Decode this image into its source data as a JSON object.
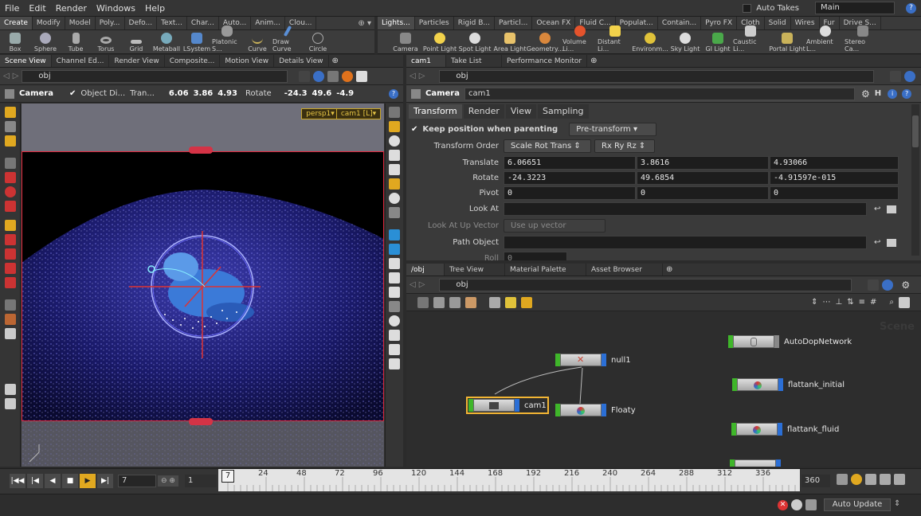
{
  "menu": [
    "File",
    "Edit",
    "Render",
    "Windows",
    "Help"
  ],
  "topright": {
    "auto_takes": "Auto Takes",
    "desktop": "Main"
  },
  "shelf_left_tabs": [
    "Create",
    "Modify",
    "Model",
    "Poly...",
    "Defo...",
    "Text...",
    "Char...",
    "Auto...",
    "Anim...",
    "Clou..."
  ],
  "shelf_right_tabs": [
    "Lights...",
    "Particles",
    "Rigid B...",
    "Particl...",
    "Ocean FX",
    "Fluid C...",
    "Populat...",
    "Contain...",
    "Pyro FX",
    "Cloth",
    "Solid",
    "Wires",
    "Fur",
    "Drive S..."
  ],
  "tools_left": [
    "Box",
    "Sphere",
    "Tube",
    "Torus",
    "Grid",
    "Metaball",
    "LSystem",
    "Platonic S...",
    "Curve",
    "Draw Curve",
    "Circle"
  ],
  "tools_right": [
    "Camera",
    "Point Light",
    "Spot Light",
    "Area Light",
    "Geometry...",
    "Volume Li...",
    "Distant Li...",
    "Environm...",
    "Sky Light",
    "GI Light",
    "Caustic Li...",
    "Portal Light",
    "Ambient L...",
    "Stereo Ca..."
  ],
  "left_tabs": [
    "Scene View",
    "Channel Ed...",
    "Render View",
    "Composite...",
    "Motion View",
    "Details View"
  ],
  "left_path": "obj",
  "viewer_toolbar": {
    "label": "Camera",
    "object_di": "Object Di...",
    "tran": "Tran...",
    "t1": "6.06",
    "t2": "3.86",
    "t3": "4.93",
    "rotate": "Rotate",
    "r1": "-24.3",
    "r2": "49.6",
    "r3": "-4.9"
  },
  "viewport": {
    "persp": "persp1▾",
    "cam": "cam1 [L]▾"
  },
  "right_tabs": [
    "cam1",
    "Take List",
    "Performance Monitor"
  ],
  "right_path": "obj",
  "parm": {
    "type": "Camera",
    "name": "cam1",
    "tabs": [
      "Transform",
      "Render",
      "View",
      "Sampling"
    ],
    "keep_position": "Keep position when parenting",
    "pre_transform": "Pre-transform",
    "transform_order_label": "Transform Order",
    "transform_order": "Scale Rot Trans",
    "rot_order": "Rx Ry Rz",
    "translate_label": "Translate",
    "translate": [
      "6.06651",
      "3.8616",
      "4.93066"
    ],
    "rotate_label": "Rotate",
    "rotate": [
      "-24.3223",
      "49.6854",
      "-4.91597e-015"
    ],
    "pivot_label": "Pivot",
    "pivot": [
      "0",
      "0",
      "0"
    ],
    "lookat_label": "Look At",
    "lookup_label": "Look At Up Vector",
    "lookup_value": "Use up vector",
    "pathobj_label": "Path Object",
    "roll_label": "Roll",
    "roll_value": "0"
  },
  "net_tabs": [
    "/obj",
    "Tree View",
    "Material Palette",
    "Asset Browser"
  ],
  "net_path": "obj",
  "net_watermark": "Scene",
  "nodes": {
    "null1": "null1",
    "cam1": "cam1",
    "floaty": "Floaty",
    "autodop": "AutoDopNetwork",
    "ft_initial": "flattank_initial",
    "ft_fluid": "flattank_fluid"
  },
  "timeline": {
    "frame": "7",
    "start": "1",
    "current": "7",
    "ticks": [
      "24",
      "48",
      "72",
      "96",
      "120",
      "144",
      "168",
      "192",
      "216",
      "240",
      "264",
      "288",
      "312",
      "336"
    ],
    "end": "360"
  },
  "status": {
    "auto_update": "Auto Update"
  }
}
